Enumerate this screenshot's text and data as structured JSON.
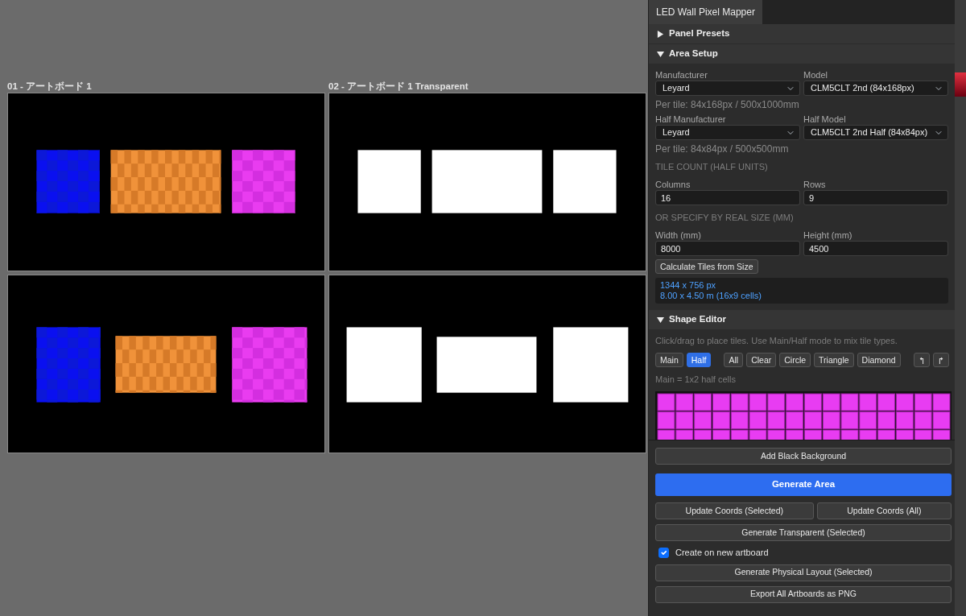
{
  "artboards": [
    {
      "label": "01 - アートボード 1",
      "kind": "colored"
    },
    {
      "label": "02 - アートボード 1 Transparent",
      "kind": "transparent"
    },
    {
      "kind": "colored"
    },
    {
      "kind": "transparent"
    }
  ],
  "panel": {
    "tab": "LED Wall Pixel Mapper",
    "sections": [
      {
        "title": "Panel Presets",
        "expanded": false
      },
      {
        "title": "Area Setup",
        "expanded": true
      },
      {
        "title": "Shape Editor",
        "expanded": true
      }
    ],
    "area_setup": {
      "manufacturer": {
        "label": "Manufacturer",
        "value": "Leyard"
      },
      "model": {
        "label": "Model",
        "value": "CLM5CLT 2nd (84x168px)"
      },
      "per_tile": "Per tile: 84x168px / 500x1000mm",
      "half_manufacturer": {
        "label": "Half Manufacturer",
        "value": "Leyard"
      },
      "half_model": {
        "label": "Half Model",
        "value": "CLM5CLT 2nd Half (84x84px)"
      },
      "half_per_tile": "Per tile: 84x84px / 500x500mm",
      "tile_count_heading": "TILE COUNT (HALF UNITS)",
      "columns": {
        "label": "Columns",
        "value": "16"
      },
      "rows": {
        "label": "Rows",
        "value": "9"
      },
      "real_size_heading": "OR SPECIFY BY REAL SIZE (MM)",
      "width": {
        "label": "Width (mm)",
        "value": "8000"
      },
      "height": {
        "label": "Height (mm)",
        "value": "4500"
      },
      "calculate_button": "Calculate Tiles from Size",
      "info_lines": [
        "1344 x 756 px",
        "8.00 x 4.50 m (16x9 cells)"
      ]
    },
    "shape_editor": {
      "hint": "Click/drag to place tiles. Use Main/Half mode to mix tile types.",
      "modes": [
        {
          "label": "Main",
          "selected": false
        },
        {
          "label": "Half",
          "selected": true
        }
      ],
      "tools": [
        "All",
        "Clear",
        "Circle",
        "Triangle",
        "Diamond"
      ],
      "note": "Main = 1x2 half cells"
    },
    "actions": {
      "add_background": "Add Black Background",
      "generate": "Generate Area",
      "update_buttons": [
        "Update Coords (Selected)",
        "Update Coords (All)"
      ],
      "generate_transparent": "Generate Transparent (Selected)",
      "create_on_new_artboard": {
        "label": "Create on new artboard",
        "checked": true
      },
      "generate_physical": "Generate Physical Layout (Selected)",
      "export": "Export All Artboards as PNG"
    }
  }
}
